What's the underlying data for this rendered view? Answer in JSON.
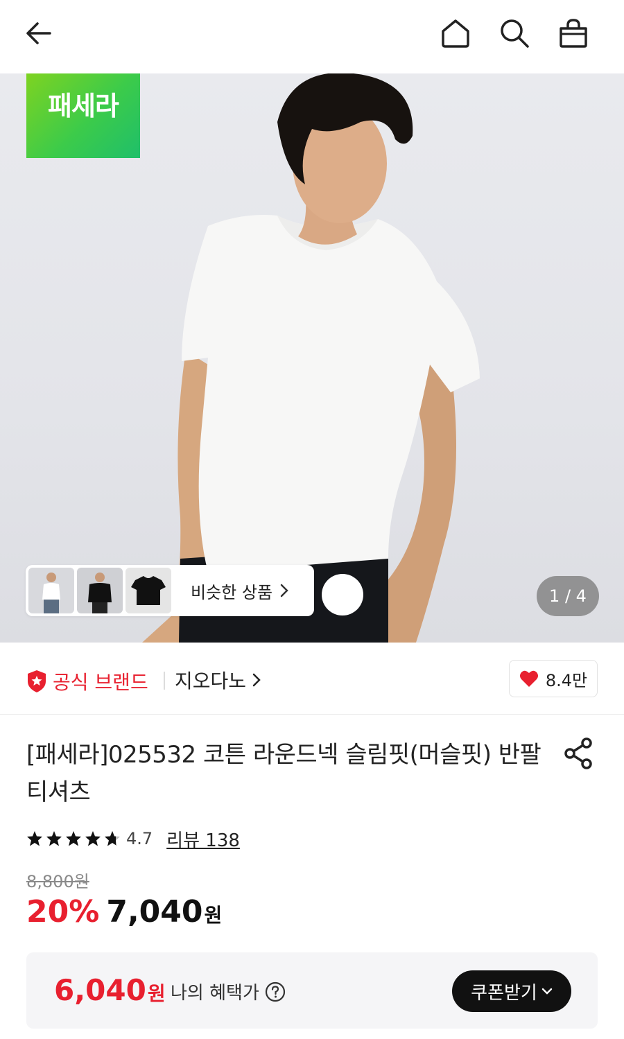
{
  "header": {
    "back_icon": "arrow-left-icon",
    "home_icon": "home-icon",
    "search_icon": "search-icon",
    "cart_icon": "shopping-bag-icon"
  },
  "hero": {
    "brand_badge": "패세라",
    "similar_label": "비슷한 상품",
    "pager": "1 / 4"
  },
  "brand_row": {
    "official_label": "공식 브랜드",
    "store_name": "지오다노",
    "likes": "8.4만",
    "accent_color": "#e8202f"
  },
  "product": {
    "title": "[패세라]025532 코튼 라운드넥 슬림핏(머슬핏) 반팔 티셔츠",
    "rating_stars": 4.7,
    "rating_value": "4.7",
    "review_label": "리뷰 138",
    "original_price": "8,800원",
    "discount": "20%",
    "sale_price": "7,040",
    "currency": "원"
  },
  "benefit": {
    "price": "6,040",
    "currency": "원",
    "label": "나의 혜택가",
    "coupon_button": "쿠폰받기"
  }
}
